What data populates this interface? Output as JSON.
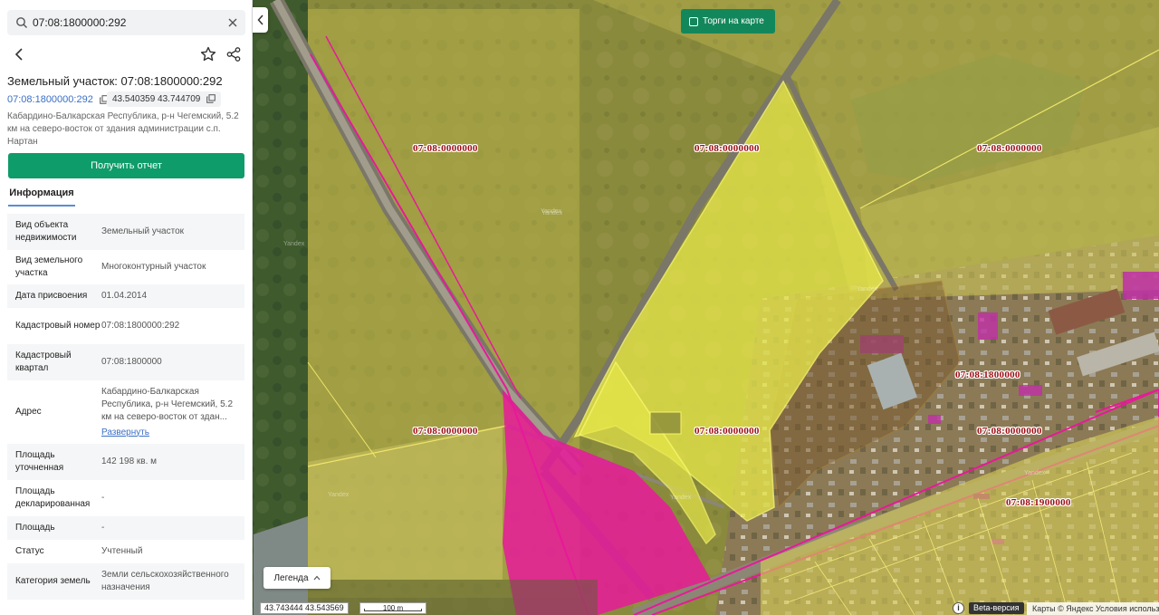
{
  "search": {
    "value": "07:08:1800000:292"
  },
  "object": {
    "title": "Земельный участок: 07:08:1800000:292",
    "cad_number": "07:08:1800000:292",
    "coords": "43.540359 43.744709",
    "address": "Кабардино-Балкарская Республика, р-н Чегемский, 5.2 км на северо-восток от здания администрации с.п. Нартан"
  },
  "report_button": "Получить отчет",
  "tabs": {
    "info": "Информация"
  },
  "info_rows": [
    {
      "label": "Вид объекта недвижимости",
      "value": "Земельный участок"
    },
    {
      "label": "Вид земельного участка",
      "value": "Многоконтурный участок"
    },
    {
      "label": "Дата присвоения",
      "value": "01.04.2014"
    },
    {
      "label": "Кадастровый номер",
      "value": "07:08:1800000:292"
    },
    {
      "label": "Кадастровый квартал",
      "value": "07:08:1800000"
    },
    {
      "label": "Адрес",
      "value": "Кабардино-Балкарская Республика, р-н Чегемский, 5.2 км  на северо-восток от здан...",
      "link": "Развернуть"
    },
    {
      "label": "Площадь уточненная",
      "value": "142 198 кв. м"
    },
    {
      "label": "Площадь декларированная",
      "value": "-"
    },
    {
      "label": "Площадь",
      "value": "-"
    },
    {
      "label": "Статус",
      "value": "Учтенный"
    },
    {
      "label": "Категория земель",
      "value": "Земли сельскохозяйственного назначения"
    }
  ],
  "map": {
    "tenders_toggle": "Торги на карте",
    "legend": "Легенда",
    "coords_readout": "43.743444  43.543569",
    "scale": "100 m",
    "beta": "Beta-версия",
    "copyright": "Карты © Яндекс   Условия использования",
    "watermark": "Yandex",
    "labels": [
      "07:08:0000000",
      "07:08:0000000",
      "07:08:0000000",
      "07:08:1800000",
      "07:08:0000000",
      "07:08:0000000",
      "07:08:0000000",
      "07:08:1900000"
    ],
    "colors": {
      "field_overlay": "#b5b34a",
      "selected_parcel": "#e3e34a",
      "magenta_zone": "#e8199a",
      "report_green": "#0e9c6a",
      "label_red": "#9b0d14"
    }
  }
}
